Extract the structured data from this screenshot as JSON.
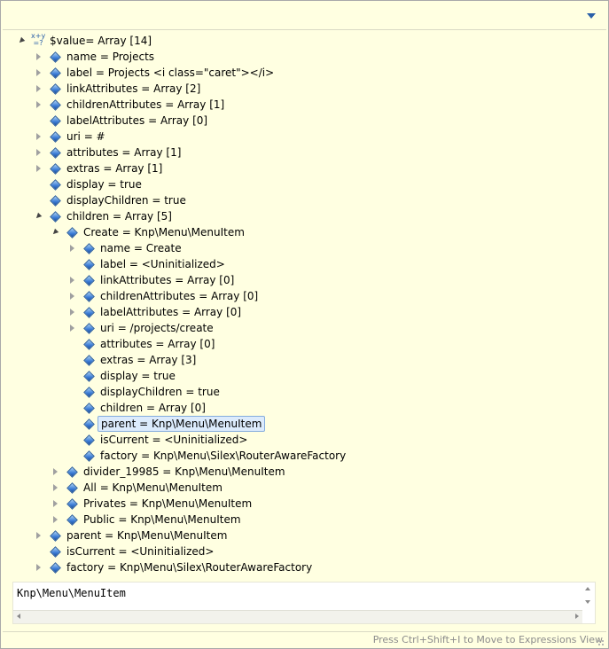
{
  "header": {
    "view_menu_icon": "chevron-down-icon"
  },
  "tree": {
    "rows": [
      {
        "id": "value",
        "label": "$value= Array [14]",
        "icon": "xy",
        "twisty": "expanded",
        "selected": false
      },
      {
        "id": "name",
        "label": "name = Projects",
        "icon": "diamond",
        "twisty": "collapsed",
        "selected": false
      },
      {
        "id": "label",
        "label": "label = Projects <i class=\"caret\"></i>",
        "icon": "diamond",
        "twisty": "collapsed",
        "selected": false
      },
      {
        "id": "linkAttributes",
        "label": "linkAttributes = Array [2]",
        "icon": "diamond",
        "twisty": "collapsed",
        "selected": false
      },
      {
        "id": "childrenAttributes",
        "label": "childrenAttributes = Array [1]",
        "icon": "diamond",
        "twisty": "collapsed",
        "selected": false
      },
      {
        "id": "labelAttributes",
        "label": "labelAttributes = Array [0]",
        "icon": "diamond",
        "twisty": "none",
        "selected": false
      },
      {
        "id": "uri",
        "label": "uri = #",
        "icon": "diamond",
        "twisty": "collapsed",
        "selected": false
      },
      {
        "id": "attributes",
        "label": "attributes = Array [1]",
        "icon": "diamond",
        "twisty": "collapsed",
        "selected": false
      },
      {
        "id": "extras",
        "label": "extras = Array [1]",
        "icon": "diamond",
        "twisty": "collapsed",
        "selected": false
      },
      {
        "id": "display",
        "label": "display = true",
        "icon": "diamond",
        "twisty": "none",
        "selected": false
      },
      {
        "id": "displayChildren",
        "label": "displayChildren = true",
        "icon": "diamond",
        "twisty": "none",
        "selected": false
      },
      {
        "id": "children",
        "label": "children = Array [5]",
        "icon": "diamond",
        "twisty": "expanded",
        "selected": false
      },
      {
        "id": "create",
        "label": "Create = Knp\\Menu\\MenuItem",
        "icon": "diamond",
        "twisty": "expanded",
        "selected": false
      },
      {
        "id": "create-name",
        "label": "name = Create",
        "icon": "diamond",
        "twisty": "collapsed",
        "selected": false
      },
      {
        "id": "create-label",
        "label": "label = <Uninitialized>",
        "icon": "diamond",
        "twisty": "none",
        "selected": false
      },
      {
        "id": "create-linkAttributes",
        "label": "linkAttributes = Array [0]",
        "icon": "diamond",
        "twisty": "collapsed",
        "selected": false
      },
      {
        "id": "create-childrenAttributes",
        "label": "childrenAttributes = Array [0]",
        "icon": "diamond",
        "twisty": "collapsed",
        "selected": false
      },
      {
        "id": "create-labelAttributes",
        "label": "labelAttributes = Array [0]",
        "icon": "diamond",
        "twisty": "collapsed",
        "selected": false
      },
      {
        "id": "create-uri",
        "label": "uri = /projects/create",
        "icon": "diamond",
        "twisty": "collapsed",
        "selected": false
      },
      {
        "id": "create-attributes",
        "label": "attributes = Array [0]",
        "icon": "diamond",
        "twisty": "none",
        "selected": false
      },
      {
        "id": "create-extras",
        "label": "extras = Array [3]",
        "icon": "diamond",
        "twisty": "none",
        "selected": false
      },
      {
        "id": "create-display",
        "label": "display = true",
        "icon": "diamond",
        "twisty": "none",
        "selected": false
      },
      {
        "id": "create-displayChildren",
        "label": "displayChildren = true",
        "icon": "diamond",
        "twisty": "none",
        "selected": false
      },
      {
        "id": "create-children",
        "label": "children = Array [0]",
        "icon": "diamond",
        "twisty": "none",
        "selected": false
      },
      {
        "id": "create-parent",
        "label": "parent = Knp\\Menu\\MenuItem",
        "icon": "diamond",
        "twisty": "none",
        "selected": true
      },
      {
        "id": "create-isCurrent",
        "label": "isCurrent = <Uninitialized>",
        "icon": "diamond",
        "twisty": "none",
        "selected": false
      },
      {
        "id": "create-factory",
        "label": "factory = Knp\\Menu\\Silex\\RouterAwareFactory",
        "icon": "diamond",
        "twisty": "none",
        "selected": false
      },
      {
        "id": "divider",
        "label": "divider_19985 = Knp\\Menu\\MenuItem",
        "icon": "diamond",
        "twisty": "collapsed",
        "selected": false
      },
      {
        "id": "all",
        "label": "All = Knp\\Menu\\MenuItem",
        "icon": "diamond",
        "twisty": "collapsed",
        "selected": false
      },
      {
        "id": "privates",
        "label": "Privates = Knp\\Menu\\MenuItem",
        "icon": "diamond",
        "twisty": "collapsed",
        "selected": false
      },
      {
        "id": "public",
        "label": "Public = Knp\\Menu\\MenuItem",
        "icon": "diamond",
        "twisty": "collapsed",
        "selected": false
      },
      {
        "id": "parent",
        "label": "parent = Knp\\Menu\\MenuItem",
        "icon": "diamond",
        "twisty": "collapsed",
        "selected": false
      },
      {
        "id": "isCurrent",
        "label": "isCurrent = <Uninitialized>",
        "icon": "diamond",
        "twisty": "none",
        "selected": false
      },
      {
        "id": "factory",
        "label": "factory = Knp\\Menu\\Silex\\RouterAwareFactory",
        "icon": "diamond",
        "twisty": "collapsed",
        "selected": false
      }
    ]
  },
  "detail": {
    "text": "Knp\\Menu\\MenuItem"
  },
  "status": {
    "hint": "Press Ctrl+Shift+I to Move to Expressions View"
  },
  "colors": {
    "background": "#ffffe1",
    "selection": "#dcebfc",
    "selection_border": "#84acdd",
    "icon_blue": "#3a7bd5"
  }
}
